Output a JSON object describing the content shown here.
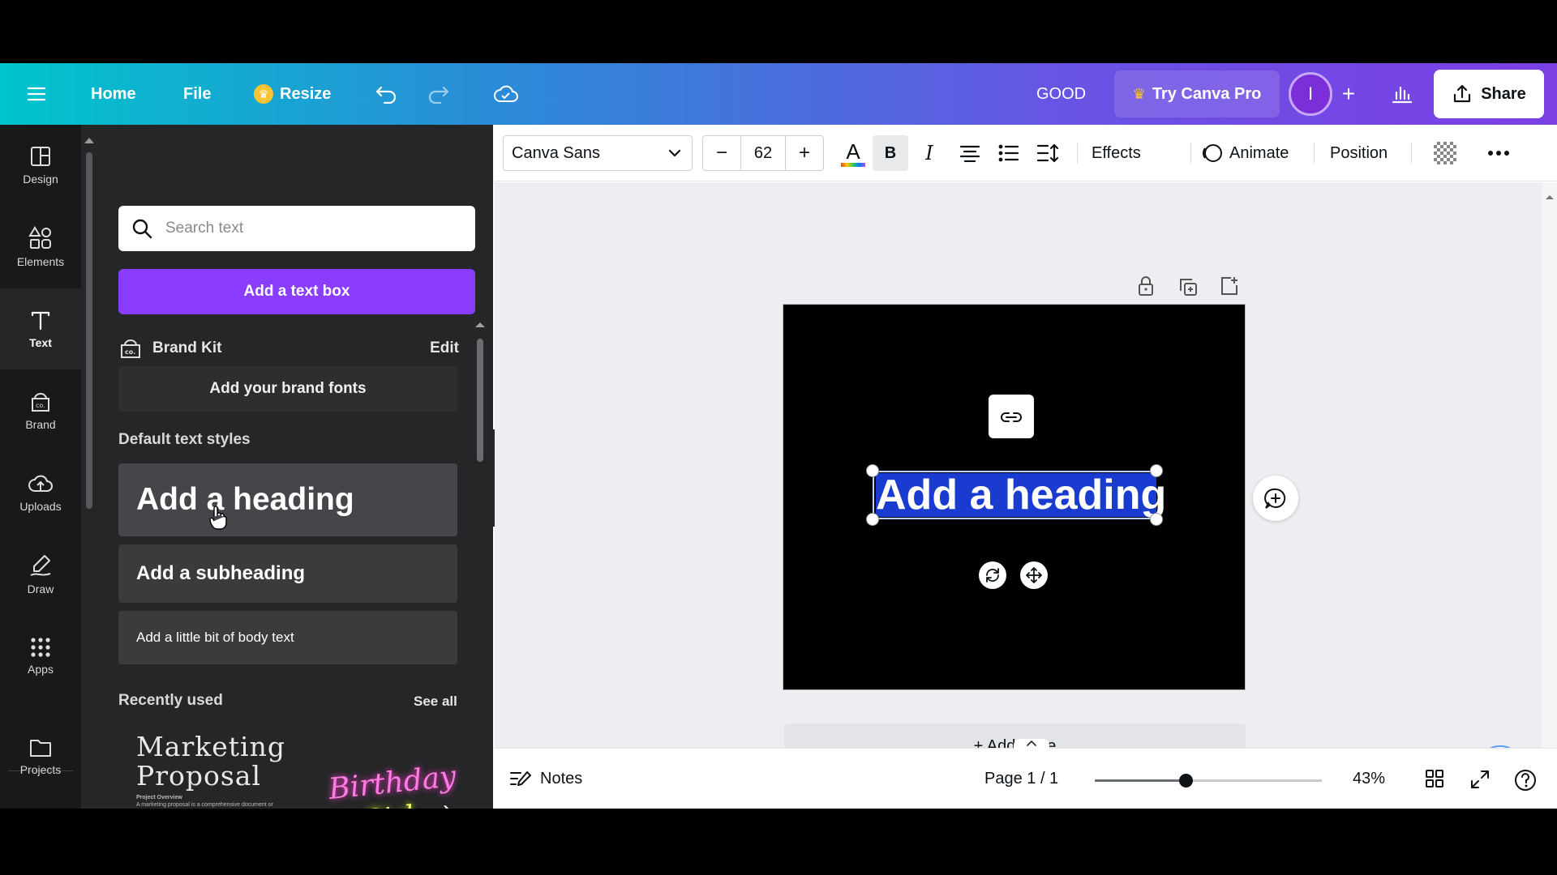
{
  "topbar": {
    "home_label": "Home",
    "file_label": "File",
    "resize_label": "Resize",
    "design_title": "GOOD",
    "try_pro_label": "Try Canva Pro",
    "avatar_initial": "I",
    "share_label": "Share"
  },
  "rail": {
    "items": [
      {
        "label": "Design",
        "icon": "design-icon"
      },
      {
        "label": "Elements",
        "icon": "elements-icon"
      },
      {
        "label": "Text",
        "icon": "text-icon"
      },
      {
        "label": "Brand",
        "icon": "brand-icon"
      },
      {
        "label": "Uploads",
        "icon": "uploads-icon"
      },
      {
        "label": "Draw",
        "icon": "draw-icon"
      },
      {
        "label": "Apps",
        "icon": "apps-icon"
      },
      {
        "label": "Projects",
        "icon": "projects-icon"
      }
    ],
    "active": "Text"
  },
  "panel": {
    "search_placeholder": "Search text",
    "add_text_box": "Add a text box",
    "brand_kit": "Brand Kit",
    "brand_kit_edit": "Edit",
    "add_brand_fonts": "Add your brand fonts",
    "default_styles_title": "Default text styles",
    "heading": "Add a heading",
    "subheading": "Add a subheading",
    "body": "Add a little bit of body text",
    "recently_used": "Recently used",
    "see_all": "See all",
    "recent_marketing_line1": "Marketing",
    "recent_marketing_line2": "Proposal",
    "recent_marketing_small_title": "Project Overview",
    "recent_marketing_small_body": "A marketing proposal is a comprehensive document or blueprint that outlines a company's advertising and marketing efforts for the coming year.",
    "recent_birthday_line1": "Birthday",
    "recent_birthday_line2": "Girl"
  },
  "toolbar": {
    "font_family": "Canva Sans",
    "font_size": "62",
    "minus": "−",
    "plus": "+",
    "bold": "B",
    "italic": "I",
    "effects": "Effects",
    "animate": "Animate",
    "position": "Position"
  },
  "canvas": {
    "selected_text": "Add a heading",
    "add_page": "+ Add page"
  },
  "bottombar": {
    "notes": "Notes",
    "page_count": "Page 1 / 1",
    "zoom": "43%",
    "zoom_fraction": 0.4
  },
  "colors": {
    "accent": "#8b3dff",
    "selection": "#1a3bcf",
    "panel_bg": "#252627",
    "rail_bg": "#18191b"
  }
}
